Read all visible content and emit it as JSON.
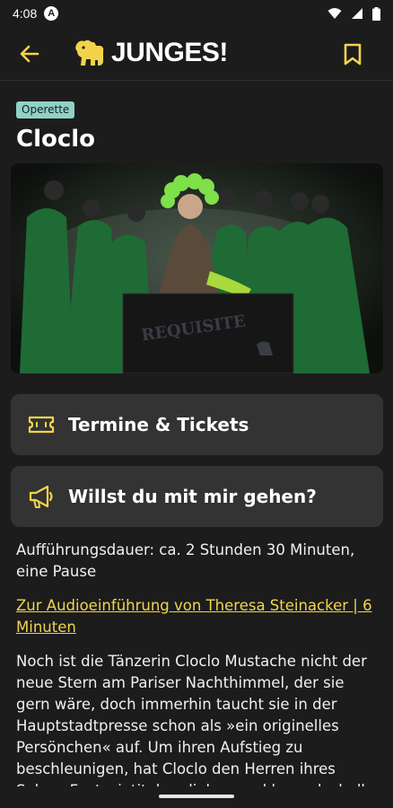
{
  "status": {
    "time": "4:08",
    "badge": "A"
  },
  "header": {
    "logo_text": "JUNGES!"
  },
  "event": {
    "category": "Operette",
    "title": "Cloclo",
    "image_caption": "REQUISITE"
  },
  "actions": [
    {
      "label": "Termine & Tickets",
      "icon": "ticket-icon"
    },
    {
      "label": "Willst du mit mir gehen?",
      "icon": "megaphone-icon"
    }
  ],
  "details": {
    "duration": "Aufführungsdauer: ca. 2 Stunden 30 Minuten, eine Pause",
    "audio_link": "Zur Audioeinführung von Theresa Steinacker | 6 Minuten",
    "description": "Noch ist die Tänzerin Cloclo Mustache nicht der neue Stern am Pariser Nachthimmel, der sie gern wäre, doch immerhin taucht sie in der Hauptstadtpresse schon als »ein originelles Persönchen« auf. Um ihren Aufstieg zu beschleunigen, hat Cloclo den Herren ihres Salons Fantasietitel verliehen und kann deshalb"
  },
  "colors": {
    "accent": "#f2d44c",
    "tag": "#8fd2c6",
    "card": "#333333",
    "background": "#1c1c1c"
  }
}
